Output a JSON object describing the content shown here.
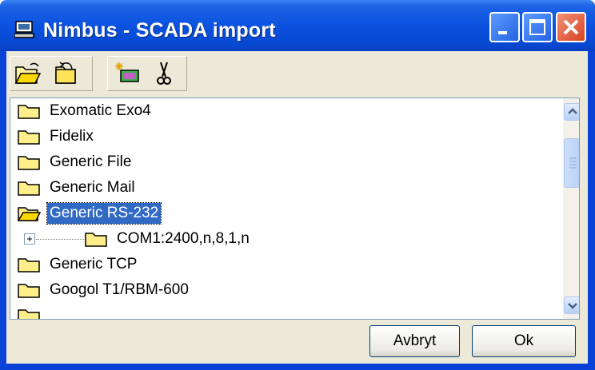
{
  "window": {
    "title": "Nimbus - SCADA import"
  },
  "titlebar_buttons": {
    "minimize": "minimize-icon",
    "maximize": "maximize-icon",
    "close": "close-icon"
  },
  "toolbar": {
    "icons": [
      "open-folder-icon",
      "undo-folder-icon",
      "new-item-icon",
      "cut-icon"
    ]
  },
  "tree": {
    "items": [
      {
        "label": "Exomatic Exo4",
        "icon": "folder-icon"
      },
      {
        "label": "Fidelix",
        "icon": "folder-icon"
      },
      {
        "label": "Generic File",
        "icon": "folder-icon"
      },
      {
        "label": "Generic Mail",
        "icon": "folder-icon"
      },
      {
        "label": "Generic RS-232",
        "icon": "open-folder-icon",
        "selected": true
      },
      {
        "label": "COM1:2400,n,8,1,n",
        "icon": "folder-icon",
        "child": true
      },
      {
        "label": "Generic TCP",
        "icon": "folder-icon"
      },
      {
        "label": "Googol T1/RBM-600",
        "icon": "folder-icon"
      }
    ]
  },
  "buttons": {
    "cancel": "Avbryt",
    "ok": "Ok"
  },
  "colors": {
    "titlebar": "#0a52df",
    "selection": "#316ac5",
    "face": "#ece9d8"
  }
}
